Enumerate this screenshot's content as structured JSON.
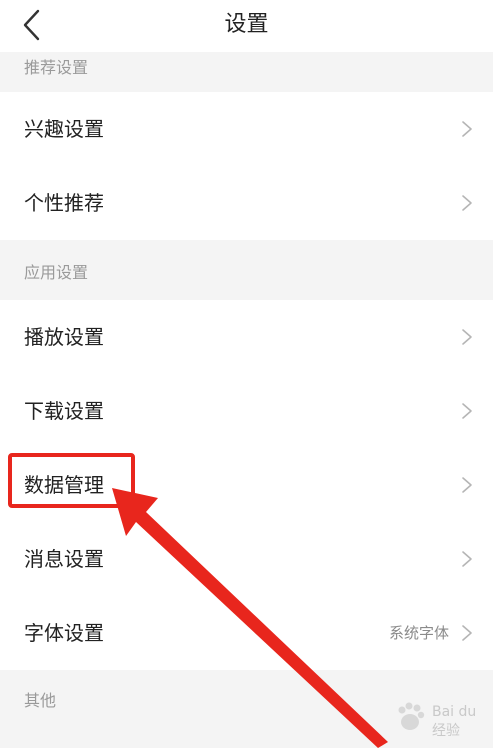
{
  "nav": {
    "title": "设置"
  },
  "sections": [
    {
      "header": "推荐设置",
      "items": [
        {
          "label": "兴趣设置",
          "value": ""
        },
        {
          "label": "个性推荐",
          "value": ""
        }
      ]
    },
    {
      "header": "应用设置",
      "items": [
        {
          "label": "播放设置",
          "value": ""
        },
        {
          "label": "下载设置",
          "value": ""
        },
        {
          "label": "数据管理",
          "value": ""
        },
        {
          "label": "消息设置",
          "value": ""
        },
        {
          "label": "字体设置",
          "value": "系统字体"
        }
      ]
    },
    {
      "header": "其他",
      "items": []
    }
  ],
  "watermark": {
    "text": "Bai du 经验"
  },
  "colors": {
    "annotation": "#e8261d",
    "section_bg": "#f4f4f4",
    "muted_text": "#9a9a9a"
  },
  "icons": {
    "back": "chevron-left-icon",
    "row": "chevron-right-icon"
  }
}
